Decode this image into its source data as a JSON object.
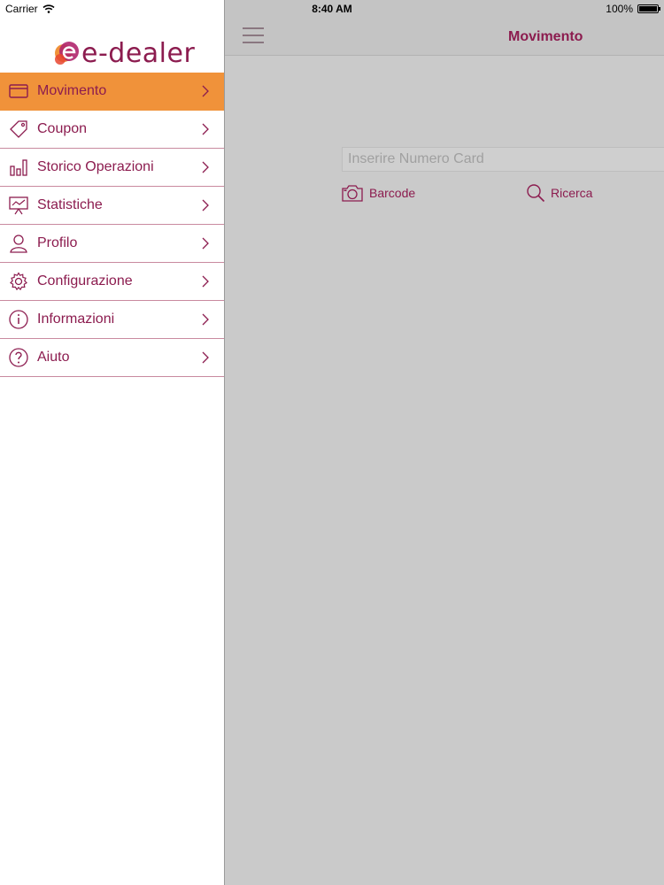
{
  "status_bar": {
    "carrier": "Carrier",
    "time": "8:40 AM",
    "battery_text": "100%",
    "battery_level": 1.0
  },
  "app": {
    "logo_text": "e-dealer",
    "brand_color": "#8c1c4f",
    "accent_color": "#f0923a"
  },
  "sidebar": {
    "items": [
      {
        "label": "Movimento",
        "icon": "card-icon",
        "active": true
      },
      {
        "label": "Coupon",
        "icon": "tag-icon",
        "active": false
      },
      {
        "label": "Storico Operazioni",
        "icon": "bar-chart-icon",
        "active": false
      },
      {
        "label": "Statistiche",
        "icon": "presentation-chart-icon",
        "active": false
      },
      {
        "label": "Profilo",
        "icon": "user-icon",
        "active": false
      },
      {
        "label": "Configurazione",
        "icon": "gear-icon",
        "active": false
      },
      {
        "label": "Informazioni",
        "icon": "info-icon",
        "active": false
      },
      {
        "label": "Aiuto",
        "icon": "help-icon",
        "active": false
      }
    ]
  },
  "main": {
    "title": "Movimento",
    "card_input": {
      "placeholder": "Inserire Numero Card",
      "value": ""
    },
    "barcode_label": "Barcode",
    "ricerca_label": "Ricerca"
  }
}
